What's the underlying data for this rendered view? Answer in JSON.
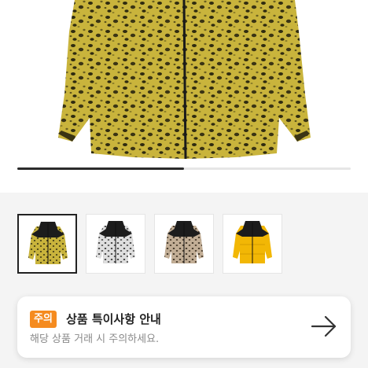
{
  "gallery": {
    "current_slide": 1,
    "total_slides": 2,
    "progress_fraction": 0.5,
    "colors": {
      "leopard_yellow": "#c8b23a",
      "leopard_spot": "#2d2a12",
      "black_shoulder": "#1c1c1c",
      "snow": "#dcdcdc",
      "tan": "#b9a48c",
      "solid_yellow": "#f2b705"
    }
  },
  "thumbnails": [
    {
      "variant": "yellow-leopard",
      "selected": true
    },
    {
      "variant": "snow-leopard",
      "selected": false
    },
    {
      "variant": "tan-leopard",
      "selected": false
    },
    {
      "variant": "solid-yellow",
      "selected": false
    }
  ],
  "notice": {
    "badge": "주의",
    "title": "상품 특이사항 안내",
    "description": "해당 상품 거래 시 주의하세요.",
    "arrow_icon": "arrow-right-icon",
    "badge_color": "#f58b1f"
  }
}
